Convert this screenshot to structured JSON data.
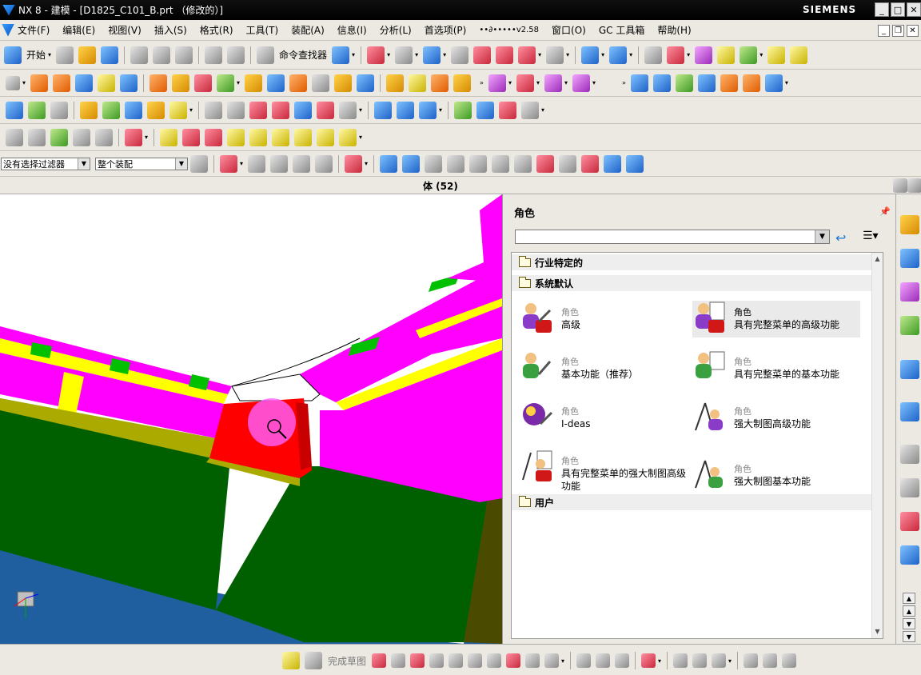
{
  "window": {
    "title": "NX 8 - 建模 - [D1825_C101_B.prt （修改的）]",
    "brand": "SIEMENS",
    "controls": [
      "_",
      "□",
      "✕"
    ]
  },
  "menu": {
    "items": [
      "文件(F)",
      "编辑(E)",
      "视图(V)",
      "插入(S)",
      "格式(R)",
      "工具(T)",
      "装配(A)",
      "信息(I)",
      "分析(L)",
      "首选项(P)",
      "••∂•••••v2.58",
      "窗口(O)",
      "GC 工具箱",
      "帮助(H)"
    ],
    "mdi_controls": [
      "_",
      "❐",
      "✕"
    ]
  },
  "toolbar": {
    "start_label": "开始",
    "command_finder": "命令查找器"
  },
  "selection": {
    "filter": "没有选择过滤器",
    "scope": "整个装配"
  },
  "status": {
    "text": "体 (52)"
  },
  "role_panel": {
    "title": "角色",
    "search_value": "",
    "groups": [
      "行业特定的",
      "系统默认",
      "用户"
    ],
    "roles": [
      {
        "caption": "角色",
        "name": "高级",
        "name2": ""
      },
      {
        "caption": "角色",
        "name": "具有完整菜单的高级功能",
        "name2": ""
      },
      {
        "caption": "角色",
        "name": "基本功能（推荐）",
        "name2": ""
      },
      {
        "caption": "角色",
        "name": "具有完整菜单的基本功能",
        "name2": ""
      },
      {
        "caption": "角色",
        "name": "I-deas",
        "name2": ""
      },
      {
        "caption": "角色",
        "name": "强大制图高级功能",
        "name2": ""
      },
      {
        "caption": "角色",
        "name": "具有完整菜单的强大制图高级",
        "name2": "功能"
      },
      {
        "caption": "角色",
        "name": "强大制图基本功能",
        "name2": ""
      }
    ]
  },
  "sketch_bar": {
    "finish_label": "完成草图"
  },
  "colors": {
    "model_magenta": "#ff00ff",
    "model_yellow": "#ffff00",
    "model_green": "#006000",
    "model_red": "#ff0000",
    "floor_blue": "#1f5fa0",
    "highlight_green": "#00ff00"
  }
}
